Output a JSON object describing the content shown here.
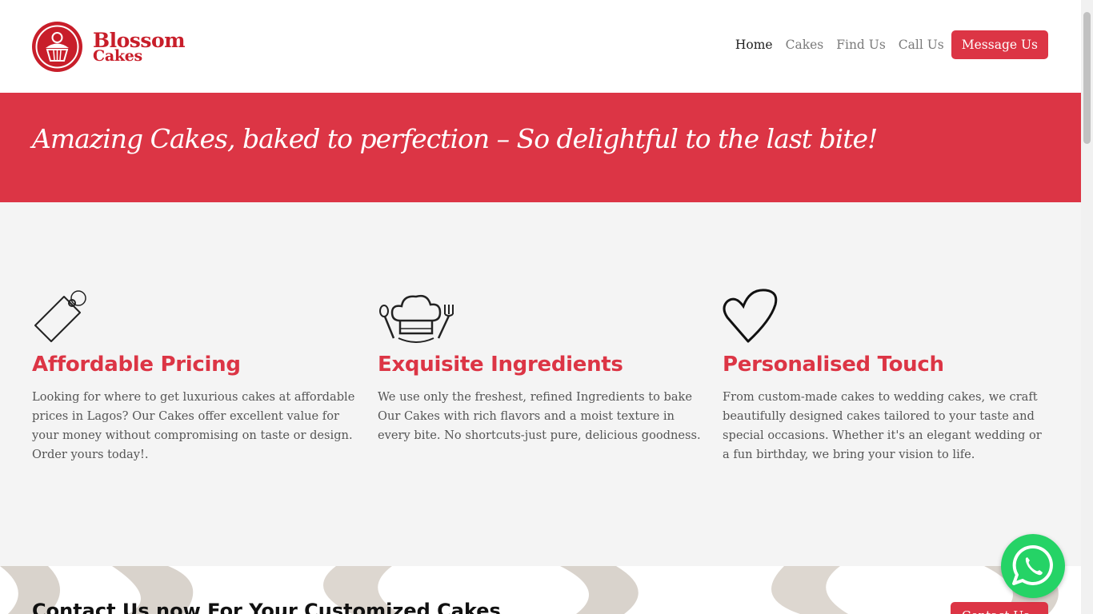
{
  "brand": {
    "line1": "Blossom",
    "line2": "Cakes",
    "color": "#c81e2a"
  },
  "nav": {
    "items": [
      {
        "label": "Home",
        "active": true
      },
      {
        "label": "Cakes",
        "active": false
      },
      {
        "label": "Find Us",
        "active": false
      },
      {
        "label": "Call Us",
        "active": false
      }
    ],
    "cta_label": "Message Us"
  },
  "banner": {
    "tagline": "Amazing Cakes, baked to perfection – So delightful to the last bite!"
  },
  "features": [
    {
      "icon": "price-tag-icon",
      "title": "Affordable Pricing",
      "text": "Looking for where to get luxurious cakes at affordable prices in Lagos? Our Cakes offer excellent value for your money without compromising on taste or design. Order yours today!."
    },
    {
      "icon": "chef-hat-utensils-icon",
      "title": "Exquisite Ingredients",
      "text": "We use only the freshest, refined Ingredients to bake Our Cakes with rich flavors and a moist texture in every bite. No shortcuts-just pure, delicious goodness."
    },
    {
      "icon": "heart-icon",
      "title": "Personalised Touch",
      "text": "From custom-made cakes to wedding cakes, we craft beautifully designed cakes tailored to your taste and special occasions. Whether it's an elegant wedding or a fun birthday, we bring your vision to life."
    }
  ],
  "contact": {
    "heading": "Contact Us now For Your Customized Cakes",
    "button_label": "Contact Us"
  },
  "colors": {
    "accent": "#dc3545",
    "whatsapp": "#25d366",
    "section_bg": "#f4f4f4"
  }
}
